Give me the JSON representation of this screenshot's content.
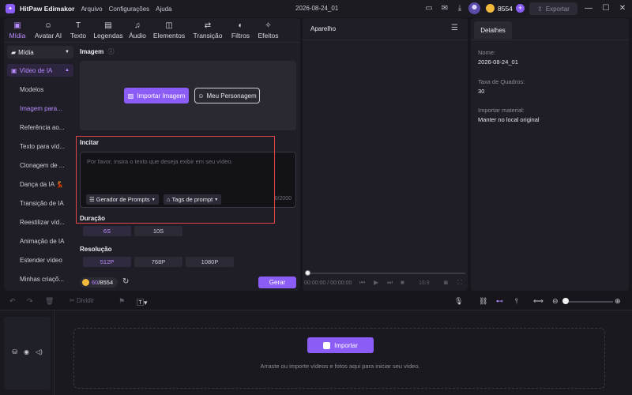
{
  "app": {
    "name": "HitPaw Edimakor",
    "menu": [
      "Arquivo",
      "Configurações",
      "Ajuda"
    ],
    "project_title": "2026-08-24_01",
    "credits": "8554",
    "export_label": "Exportar"
  },
  "tabs": [
    {
      "label": "Mídia",
      "icon": "media-icon",
      "glyph": "▣"
    },
    {
      "label": "Avatar AI",
      "icon": "avatar-icon",
      "glyph": "☺"
    },
    {
      "label": "Texto",
      "icon": "text-icon",
      "glyph": "T"
    },
    {
      "label": "Legendas",
      "icon": "subtitles-icon",
      "glyph": "▤"
    },
    {
      "label": "Áudio",
      "icon": "audio-icon",
      "glyph": "♫"
    },
    {
      "label": "Elementos",
      "icon": "elements-icon",
      "glyph": "◫"
    },
    {
      "label": "Transição",
      "icon": "transition-icon",
      "glyph": "⇄"
    },
    {
      "label": "Filtros",
      "icon": "filters-icon",
      "glyph": "◐"
    },
    {
      "label": "Efeitos",
      "icon": "effects-icon",
      "glyph": "✧"
    }
  ],
  "sidebar": {
    "media_label": "Mídia",
    "ai_video_label": "Vídeo de IA",
    "items": [
      "Modelos",
      "Imagem para...",
      "Referência ao...",
      "Texto para víd...",
      "Clonagem de ...",
      "Dança da IA 💃",
      "Transição de IA",
      "Reestilizar víd...",
      "Animação de IA",
      "Estender vídeo",
      "Minhas criaçõ..."
    ]
  },
  "form": {
    "image_label": "Imagem",
    "import_image": "Importar Imagem",
    "my_persona": "Meu Personagem",
    "prompt_label": "Incitar",
    "prompt_placeholder": "Por favor, insira o texto que deseja exibir em seu vídeo.",
    "prompt_generator": "Gerador de Prompts",
    "prompt_tags": "Tags de prompt",
    "prompt_counter": "0/2000",
    "duration_label": "Duração",
    "durations": [
      "6S",
      "10S"
    ],
    "resolution_label": "Resolução",
    "resolutions": [
      "512P",
      "768P",
      "1080P"
    ],
    "credit_cost": "60",
    "credit_total": "/8554",
    "generate": "Gerar"
  },
  "player": {
    "title": "Aparelho",
    "time": "00:00:00 / 00:00:00",
    "ratio": "16:9"
  },
  "details": {
    "tab": "Detalhes",
    "name_label": "Nome:",
    "name_value": "2026-08-24_01",
    "fps_label": "Taxa de Quadros:",
    "fps_value": "30",
    "import_label": "Importar material:",
    "import_value": "Manter no local original"
  },
  "toolbar": {
    "split": "Dividir"
  },
  "timeline": {
    "import": "Importar",
    "hint": "Arraste ou importe vídeos e fotos aqui para iniciar seu vídeo."
  },
  "colors": {
    "accent": "#8b5cf6",
    "highlight_border": "#e04848",
    "background": "#17161c"
  }
}
